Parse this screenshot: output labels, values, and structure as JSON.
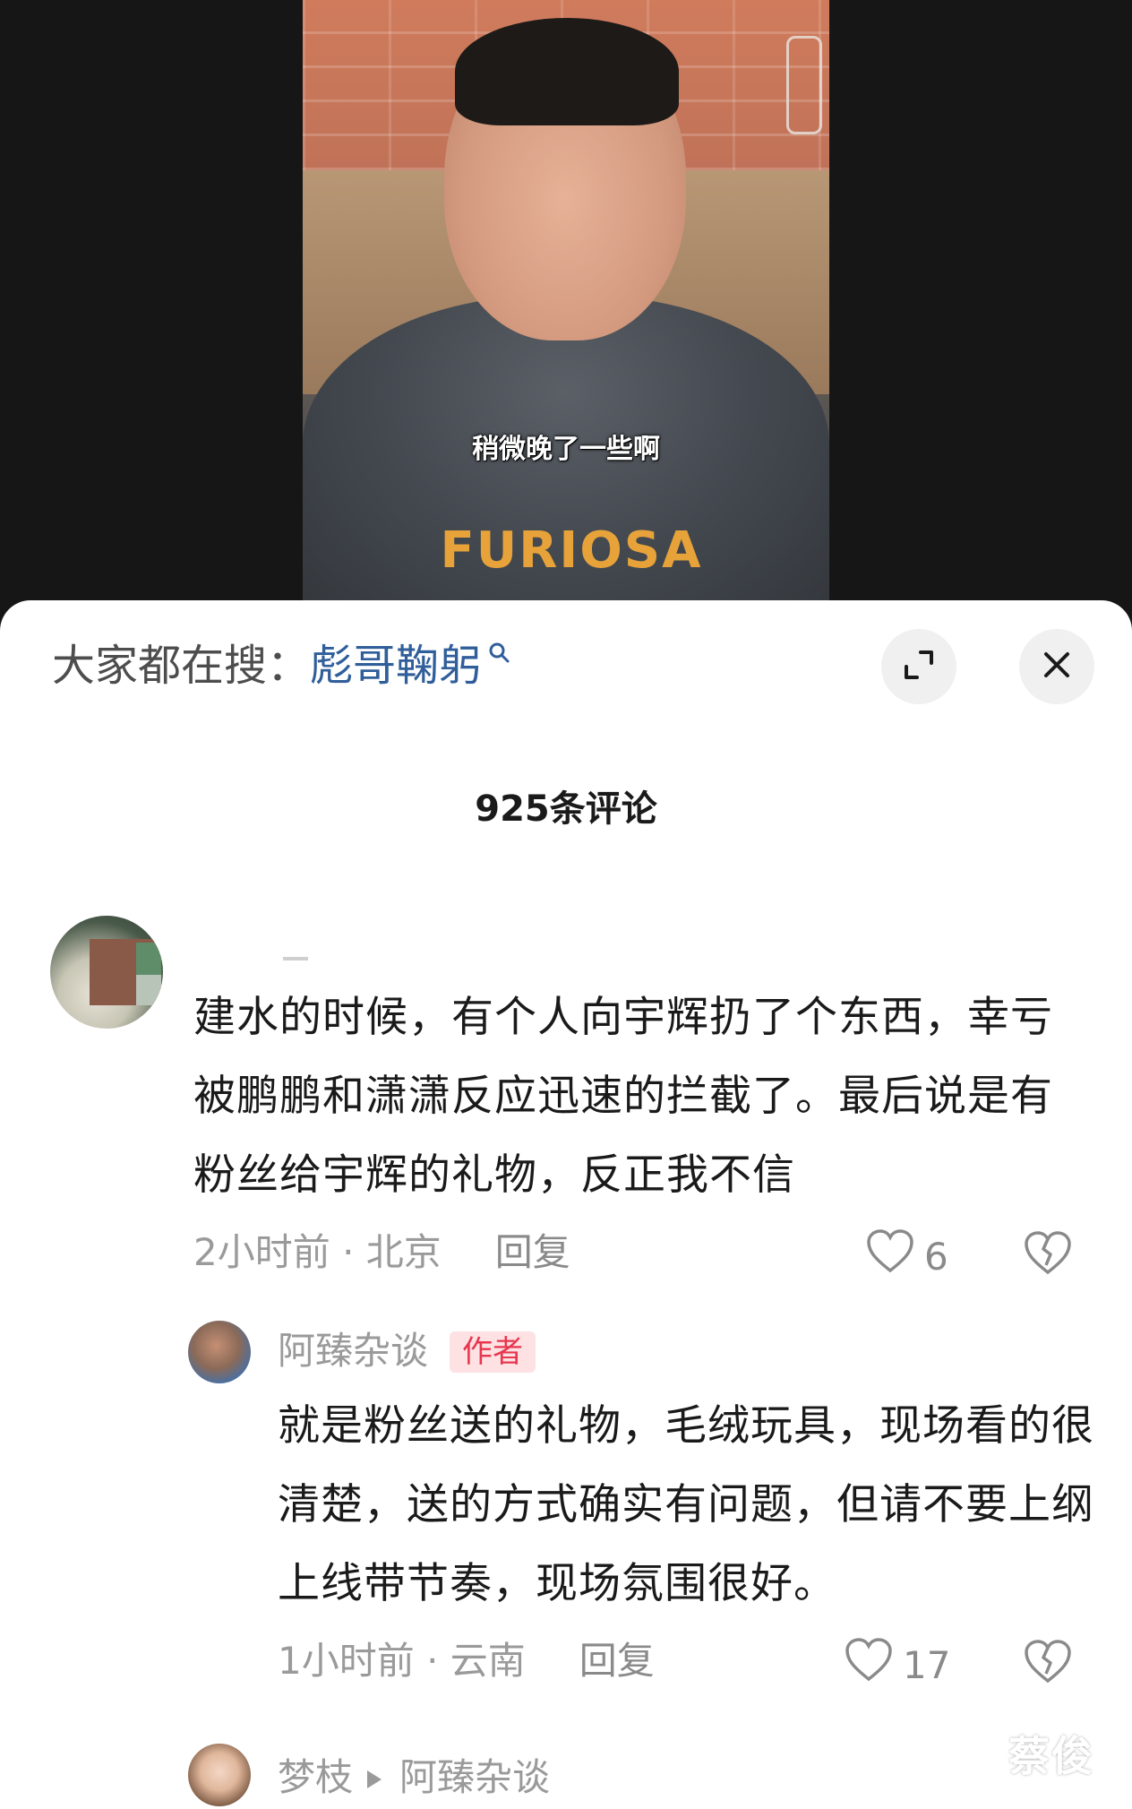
{
  "video": {
    "subtitle": "稍微晚了一些啊",
    "shirt_text": "FURIOSA"
  },
  "search": {
    "prefix": "大家都在搜：",
    "term": "彪哥鞠躬"
  },
  "header": {
    "comment_count": "925条评论"
  },
  "comments": [
    {
      "text": "建水的时候，有个人向宇辉扔了个东西，幸亏被鹏鹏和潇潇反应迅速的拦截了。最后说是有粉丝给宇辉的礼物，反正我不信",
      "time_location": "2小时前 · 北京",
      "reply_label": "回复",
      "likes": "6"
    }
  ],
  "reply": {
    "username": "阿臻杂谈",
    "tag": "作者",
    "text": "就是粉丝送的礼物，毛绒玩具，现场看的很清楚，送的方式确实有问题，但请不要上纲上线带节奏，现场氛围很好。",
    "time_location": "1小时前 · 云南",
    "reply_label": "回复",
    "likes": "17"
  },
  "next_reply": {
    "username": "梦枝",
    "reply_to": "阿臻杂谈"
  },
  "watermark": "蔡俊",
  "colors": {
    "search_term": "#305e9a",
    "author_tag_bg": "#fde1e3",
    "author_tag_text": "#e8364f",
    "meta_gray": "#9a9a9a"
  },
  "icons": [
    "search-mini-icon",
    "expand-icon",
    "close-icon",
    "heart-icon",
    "dislike-heart-icon",
    "play-arrow-icon"
  ]
}
